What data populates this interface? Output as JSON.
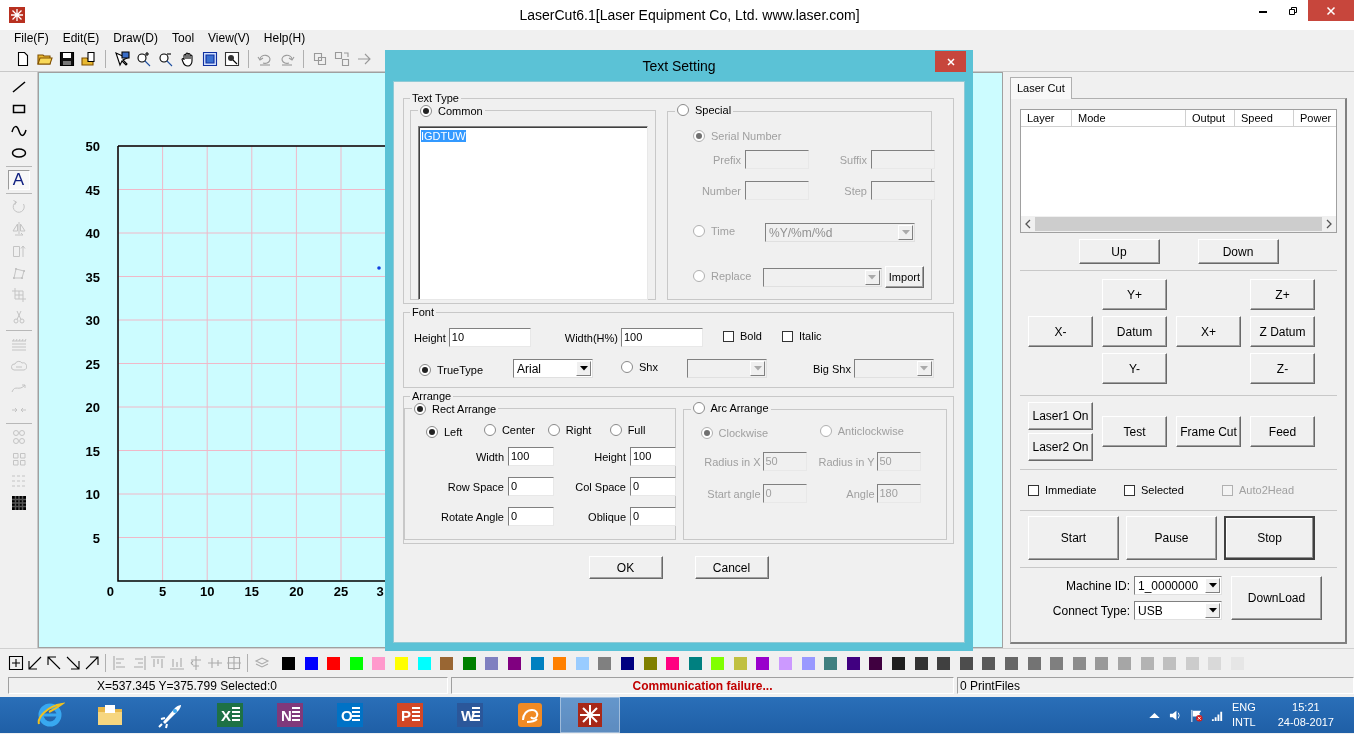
{
  "window": {
    "title": "LaserCut6.1[Laser Equipment Co, Ltd. www.laser.com]"
  },
  "menu": [
    "File(F)",
    "Edit(E)",
    "Draw(D)",
    "Tool",
    "View(V)",
    "Help(H)"
  ],
  "drawing_tools": [
    {
      "selected": false,
      "disabled": false
    },
    {
      "selected": false,
      "disabled": false
    },
    {
      "selected": false,
      "disabled": false
    },
    {
      "selected": false,
      "disabled": false
    },
    {
      "selected": true,
      "disabled": false,
      "glyph": "A"
    },
    {
      "selected": false,
      "disabled": true
    },
    {
      "selected": false,
      "disabled": true
    },
    {
      "selected": false,
      "disabled": true
    },
    {
      "selected": false,
      "disabled": true
    },
    {
      "selected": false,
      "disabled": true
    },
    {
      "selected": false,
      "disabled": true
    },
    {
      "selected": false,
      "disabled": true
    },
    {
      "selected": false,
      "disabled": true
    },
    {
      "selected": false,
      "disabled": true
    },
    {
      "selected": false,
      "disabled": true
    },
    {
      "selected": false,
      "disabled": true
    },
    {
      "selected": false,
      "disabled": true
    },
    {
      "selected": false,
      "disabled": true
    },
    {
      "selected": false,
      "disabled": false
    }
  ],
  "canvas": {
    "y_labels": [
      "50",
      "45",
      "40",
      "35",
      "30",
      "25",
      "20",
      "15",
      "10",
      "5"
    ],
    "x_labels": [
      "0",
      "5",
      "10",
      "15",
      "20",
      "25",
      "3"
    ]
  },
  "dialog": {
    "title": "Text Setting",
    "text_type": {
      "label": "Text Type",
      "common": {
        "label": "Common",
        "selected": true,
        "text": "IGDTUW"
      },
      "special": {
        "label": "Special",
        "selected": false,
        "modes": [
          {
            "label": "Serial Number",
            "selected": true
          },
          {
            "label": "Time",
            "selected": false,
            "value": "%Y/%m/%d"
          },
          {
            "label": "Replace",
            "selected": false
          }
        ],
        "fields": [
          {
            "label": "Prefix"
          },
          {
            "label": "Suffix"
          },
          {
            "label": "Number"
          },
          {
            "label": "Step"
          }
        ],
        "import_button": "Import"
      }
    },
    "font": {
      "label": "Font",
      "height": {
        "label": "Height",
        "value": "10"
      },
      "width": {
        "label": "Width(H%)",
        "value": "100"
      },
      "styles": [
        {
          "label": "Bold",
          "checked": false
        },
        {
          "label": "Italic",
          "checked": false
        }
      ],
      "types": [
        {
          "label": "TrueType",
          "selected": true,
          "value": "Arial"
        },
        {
          "label": "Shx",
          "selected": false
        }
      ],
      "big_shx": {
        "label": "Big Shx"
      }
    },
    "arrange": {
      "label": "Arrange",
      "rect": {
        "label": "Rect Arrange",
        "selected": true,
        "alignments": [
          {
            "label": "Left",
            "selected": true
          },
          {
            "label": "Center",
            "selected": false
          },
          {
            "label": "Right",
            "selected": false
          },
          {
            "label": "Full",
            "selected": false
          }
        ],
        "fields": [
          {
            "label": "Width",
            "value": "100"
          },
          {
            "label": "Height",
            "value": "100"
          },
          {
            "label": "Row Space",
            "value": "0"
          },
          {
            "label": "Col Space",
            "value": "0"
          },
          {
            "label": "Rotate Angle",
            "value": "0"
          },
          {
            "label": "Oblique",
            "value": "0"
          }
        ]
      },
      "arc": {
        "label": "Arc Arrange",
        "selected": false,
        "directions": [
          {
            "label": "Clockwise",
            "selected": true
          },
          {
            "label": "Anticlockwise",
            "selected": false
          }
        ],
        "fields": [
          {
            "label": "Radius in X",
            "value": "50"
          },
          {
            "label": "Radius in Y",
            "value": "50"
          },
          {
            "label": "Start angle",
            "value": "0"
          },
          {
            "label": "Angle",
            "value": "180"
          }
        ]
      }
    },
    "buttons": [
      "OK",
      "Cancel"
    ]
  },
  "panel": {
    "tab": "Laser Cut",
    "columns": [
      "Layer",
      "Mode",
      "Output",
      "Speed",
      "Power"
    ],
    "order_buttons": [
      "Up",
      "Down"
    ],
    "jog_buttons": [
      "Y+",
      "Z+",
      "X-",
      "Datum",
      "X+",
      "Z Datum",
      "Y-",
      "Z-"
    ],
    "laser_buttons": [
      "Laser1 On",
      "Laser2 On"
    ],
    "action_buttons": [
      "Test",
      "Frame Cut",
      "Feed"
    ],
    "options": [
      {
        "label": "Immediate",
        "checked": false,
        "disabled": false
      },
      {
        "label": "Selected",
        "checked": false,
        "disabled": false
      },
      {
        "label": "Auto2Head",
        "checked": false,
        "disabled": true
      }
    ],
    "run_buttons": [
      {
        "label": "Start",
        "focused": false
      },
      {
        "label": "Pause",
        "focused": false
      },
      {
        "label": "Stop",
        "focused": true
      }
    ],
    "machine_id": {
      "label": "Machine ID:",
      "value": "1_0000000"
    },
    "connect_type": {
      "label": "Connect Type:",
      "value": "USB"
    },
    "download_button": "DownLoad"
  },
  "palette": [
    {
      "color": "#000000"
    },
    {
      "color": "#0000ff"
    },
    {
      "color": "#ff0000"
    },
    {
      "color": "#00ff00"
    },
    {
      "color": "#ff99cc"
    },
    {
      "color": "#ffff00"
    },
    {
      "color": "#00ffff"
    },
    {
      "color": "#996633"
    },
    {
      "color": "#008000"
    },
    {
      "color": "#8080c0"
    },
    {
      "color": "#800080"
    },
    {
      "color": "#0080c0"
    },
    {
      "color": "#ff8000"
    },
    {
      "color": "#99ccff"
    },
    {
      "color": "#808080"
    },
    {
      "color": "#000080"
    },
    {
      "color": "#808000"
    },
    {
      "color": "#ff0080"
    },
    {
      "color": "#008080"
    },
    {
      "color": "#80ff00"
    },
    {
      "color": "#c0c040"
    },
    {
      "color": "#9900cc"
    },
    {
      "color": "#cc99ff"
    },
    {
      "color": "#9999ff"
    },
    {
      "color": "#408080"
    },
    {
      "color": "#400080"
    },
    {
      "color": "#400040"
    },
    {
      "color": "#202020"
    },
    {
      "color": "#333333"
    },
    {
      "color": "#404040"
    },
    {
      "color": "#4d4d4d"
    },
    {
      "color": "#595959"
    },
    {
      "color": "#666666"
    },
    {
      "color": "#737373"
    },
    {
      "color": "#7f7f7f"
    },
    {
      "color": "#8c8c8c"
    },
    {
      "color": "#999999"
    },
    {
      "color": "#a6a6a6"
    },
    {
      "color": "#b3b3b3"
    },
    {
      "color": "#bfbfbf"
    },
    {
      "color": "#cccccc"
    },
    {
      "color": "#d9d9d9"
    },
    {
      "color": "#e6e6e6"
    }
  ],
  "status_bar": {
    "position": "X=537.345 Y=375.799 Selected:0",
    "message": "Communication failure...",
    "print_files": "0 PrintFiles"
  },
  "taskbar": {
    "apps": [
      {
        "kind": "browser",
        "selected": false
      },
      {
        "kind": "folder",
        "selected": false
      },
      {
        "kind": "rocket",
        "selected": false
      },
      {
        "kind": "letter",
        "letter": "X",
        "color": "#1e7145",
        "selected": false
      },
      {
        "kind": "letter",
        "letter": "N",
        "color": "#80397b",
        "selected": false
      },
      {
        "kind": "letter",
        "letter": "O",
        "color": "#0072c6",
        "selected": false
      },
      {
        "kind": "letter",
        "letter": "P",
        "color": "#d24726",
        "selected": false
      },
      {
        "kind": "letter",
        "letter": "W",
        "color": "#2b579a",
        "selected": false
      },
      {
        "kind": "squirrel",
        "selected": false
      },
      {
        "kind": "laser",
        "selected": true
      }
    ],
    "language": "ENG",
    "layout": "INTL",
    "time": "15:21",
    "date": "24-08-2017"
  }
}
